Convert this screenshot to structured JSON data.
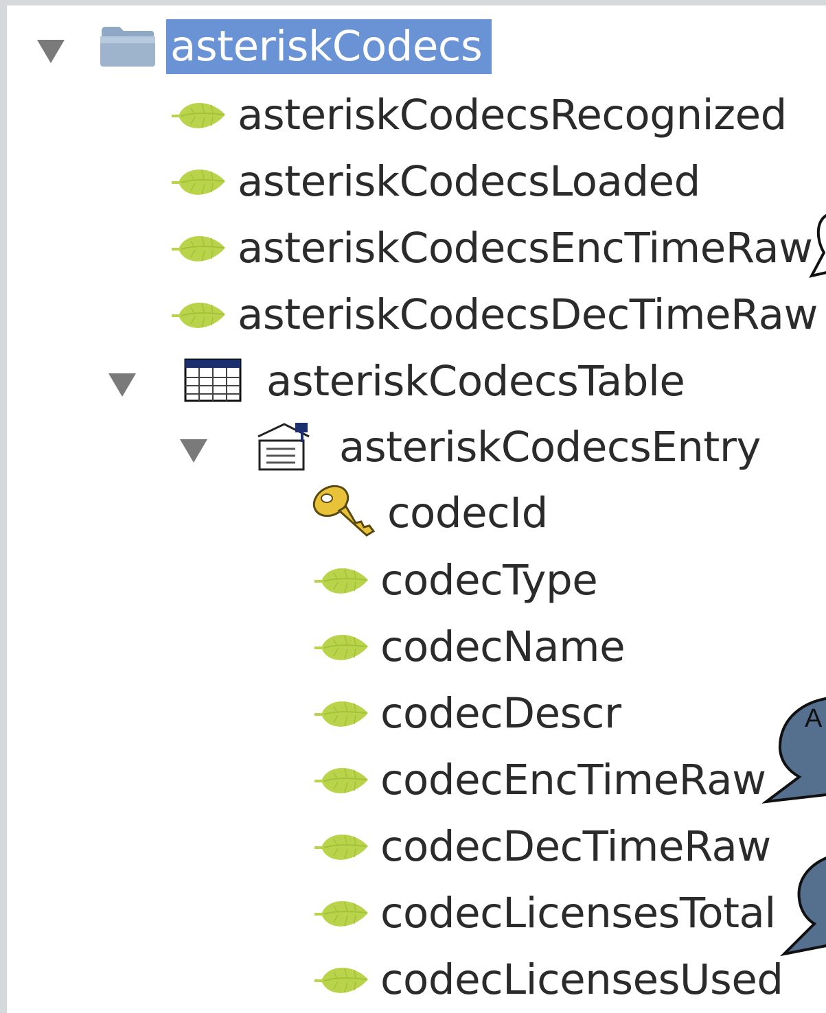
{
  "tree": {
    "root": {
      "label": "asteriskCodecs",
      "icon": "folder-icon",
      "expanded": true,
      "selected": true
    },
    "scalars": [
      {
        "label": "asteriskCodecsRecognized",
        "icon": "leaf-icon"
      },
      {
        "label": "asteriskCodecsLoaded",
        "icon": "leaf-icon"
      },
      {
        "label": "asteriskCodecsEncTimeRaw",
        "icon": "leaf-icon"
      },
      {
        "label": "asteriskCodecsDecTimeRaw",
        "icon": "leaf-icon"
      }
    ],
    "table": {
      "label": "asteriskCodecsTable",
      "icon": "table-icon",
      "expanded": true
    },
    "entry": {
      "label": "asteriskCodecsEntry",
      "icon": "entry-icon",
      "expanded": true
    },
    "index": {
      "label": "codecId",
      "icon": "key-icon"
    },
    "columns": [
      {
        "label": "codecType",
        "icon": "leaf-icon"
      },
      {
        "label": "codecName",
        "icon": "leaf-icon"
      },
      {
        "label": "codecDescr",
        "icon": "leaf-icon"
      },
      {
        "label": "codecEncTimeRaw",
        "icon": "leaf-icon"
      },
      {
        "label": "codecDecTimeRaw",
        "icon": "leaf-icon"
      },
      {
        "label": "codecLicensesTotal",
        "icon": "leaf-icon"
      },
      {
        "label": "codecLicensesUsed",
        "icon": "leaf-icon"
      }
    ]
  },
  "callouts": [
    {
      "text": "A"
    }
  ],
  "colors": {
    "selection": "#6a93d6",
    "leaf": "#b9d44a",
    "callout": "#55708f",
    "disclosure": "#7a7a7a"
  }
}
